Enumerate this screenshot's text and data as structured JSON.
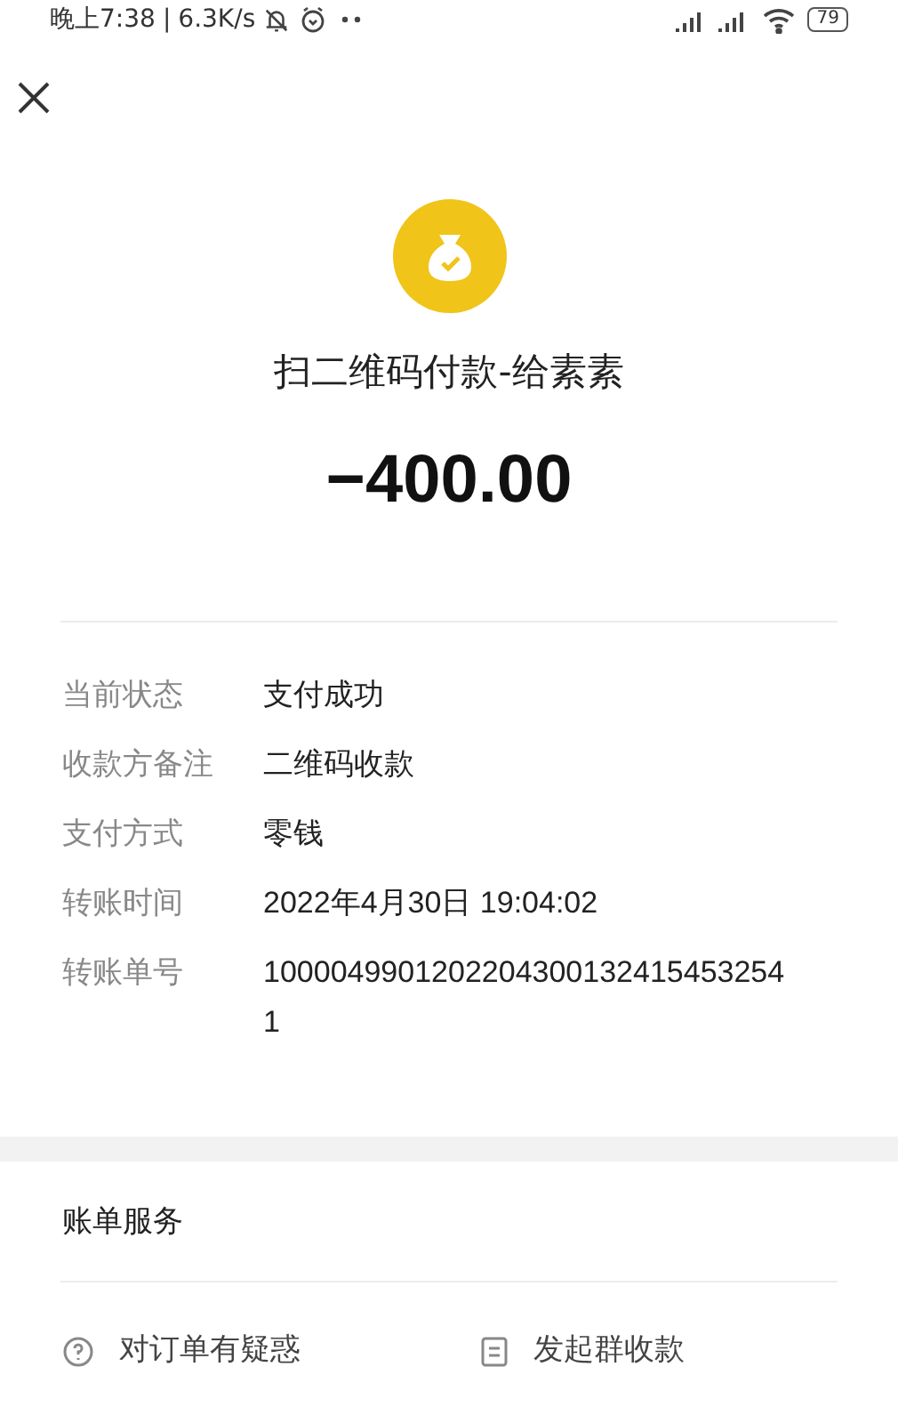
{
  "status_bar": {
    "time": "晚上7:38",
    "separator": "|",
    "speed": "6.3K/s",
    "battery": "79"
  },
  "title": "扫二维码付款-给素素",
  "amount": "−400.00",
  "details": [
    {
      "label": "当前状态",
      "value": "支付成功"
    },
    {
      "label": "收款方备注",
      "value": "二维码收款"
    },
    {
      "label": "支付方式",
      "value": "零钱"
    },
    {
      "label": "转账时间",
      "value": "2022年4月30日 19:04:02"
    },
    {
      "label": "转账单号",
      "value": "10000499012022043001324154532541"
    }
  ],
  "bill_services": {
    "title": "账单服务",
    "actions": [
      {
        "kind": "question",
        "label": "对订单有疑惑"
      },
      {
        "kind": "group",
        "label": "发起群收款"
      }
    ]
  }
}
